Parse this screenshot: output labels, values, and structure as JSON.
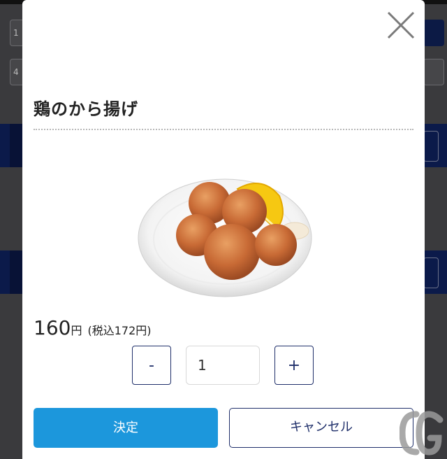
{
  "background": {
    "field_1_text": "1",
    "field_2_text": "4"
  },
  "modal": {
    "title": "鶏のから揚げ",
    "image_alt": "fried-chicken-plate",
    "price": {
      "amount": "160",
      "unit": "円",
      "tax_included": "(税込172円)"
    },
    "quantity": {
      "minus_label": "-",
      "value": "1",
      "plus_label": "+"
    },
    "buttons": {
      "confirm": "決定",
      "cancel": "キャンセル"
    }
  },
  "colors": {
    "confirm_bg": "#1c97dc",
    "navy": "#1f2f6a",
    "background_band": "#0b1a4a"
  },
  "icons": {
    "close": "close-icon",
    "watermark": "watermark-logo"
  }
}
